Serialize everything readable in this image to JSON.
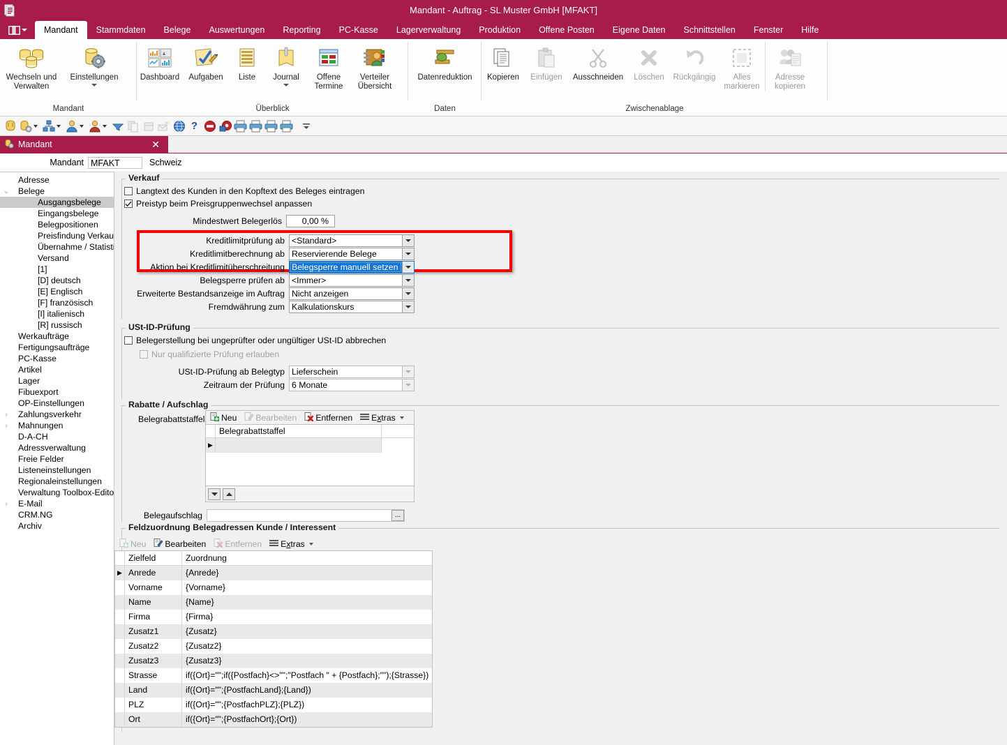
{
  "window": {
    "title": "Mandant - Auftrag - SL Muster GmbH [MFAKT]",
    "app_icon": "application-icon",
    "accent_color": "#A81C4A"
  },
  "ribbon": {
    "quick_access_menu_icon": "ribbon-menu-icon",
    "tabs": [
      {
        "label": "Mandant",
        "active": true
      },
      {
        "label": "Stammdaten",
        "active": false
      },
      {
        "label": "Belege",
        "active": false
      },
      {
        "label": "Auswertungen",
        "active": false
      },
      {
        "label": "Reporting",
        "active": false
      },
      {
        "label": "PC-Kasse",
        "active": false
      },
      {
        "label": "Lagerverwaltung",
        "active": false
      },
      {
        "label": "Produktion",
        "active": false
      },
      {
        "label": "Offene Posten",
        "active": false
      },
      {
        "label": "Eigene Daten",
        "active": false
      },
      {
        "label": "Schnittstellen",
        "active": false
      },
      {
        "label": "Fenster",
        "active": false
      },
      {
        "label": "Hilfe",
        "active": false
      }
    ],
    "groups": [
      {
        "label": "Mandant",
        "buttons": [
          {
            "label": "Wechseln und Verwalten",
            "icon": "databases-icon",
            "disabled": false,
            "dropdown": false
          },
          {
            "label": "Einstellungen",
            "icon": "database-gear-icon",
            "disabled": false,
            "dropdown": true
          }
        ]
      },
      {
        "label": "Überblick",
        "buttons": [
          {
            "label": "Dashboard",
            "icon": "dashboard-icon",
            "disabled": false,
            "dropdown": false
          },
          {
            "label": "Aufgaben",
            "icon": "tasks-icon",
            "disabled": false,
            "dropdown": false
          },
          {
            "label": "Liste",
            "icon": "list-icon",
            "disabled": false,
            "dropdown": false
          },
          {
            "label": "Journal",
            "icon": "journal-icon",
            "disabled": false,
            "dropdown": true
          },
          {
            "label": "Offene Termine",
            "icon": "calendar-icon",
            "disabled": false,
            "dropdown": false
          },
          {
            "label": "Verteiler Übersicht",
            "icon": "distributor-icon",
            "disabled": false,
            "dropdown": false
          }
        ]
      },
      {
        "label": "Daten",
        "buttons": [
          {
            "label": "Datenreduktion",
            "icon": "data-reduction-icon",
            "disabled": false,
            "dropdown": false
          }
        ]
      },
      {
        "label": "Zwischenablage",
        "buttons": [
          {
            "label": "Kopieren",
            "icon": "copy-icon",
            "disabled": false,
            "dropdown": false
          },
          {
            "label": "Einfügen",
            "icon": "paste-icon",
            "disabled": true,
            "dropdown": false
          },
          {
            "label": "Ausschneiden",
            "icon": "cut-icon",
            "disabled": true,
            "dropdown": false
          },
          {
            "label": "Löschen",
            "icon": "delete-icon",
            "disabled": true,
            "dropdown": false
          },
          {
            "label": "Rückgängig",
            "icon": "undo-icon",
            "disabled": true,
            "dropdown": false
          },
          {
            "label": "Alles markieren",
            "icon": "select-all-icon",
            "disabled": true,
            "dropdown": false
          },
          {
            "label": "Adresse kopieren",
            "icon": "copy-address-icon",
            "disabled": true,
            "dropdown": false
          }
        ]
      }
    ]
  },
  "quickbar": {
    "buttons": [
      {
        "icon": "client-icon",
        "dropdown": false,
        "disabled": false
      },
      {
        "icon": "client-settings-icon",
        "dropdown": true,
        "disabled": false
      },
      {
        "icon": "org-chart-icon",
        "dropdown": true,
        "disabled": false
      },
      {
        "icon": "customer-icon",
        "dropdown": true,
        "disabled": false
      },
      {
        "icon": "supplier-icon",
        "dropdown": true,
        "disabled": false
      },
      {
        "icon": "filter-icon",
        "dropdown": false,
        "disabled": false
      },
      {
        "icon": "copy-records-icon",
        "dropdown": false,
        "disabled": true
      },
      {
        "icon": "package-icon",
        "dropdown": false,
        "disabled": true
      },
      {
        "icon": "mail-send-icon",
        "dropdown": false,
        "disabled": true
      },
      {
        "icon": "globe-icon",
        "dropdown": false,
        "disabled": false
      },
      {
        "icon": "help-icon",
        "dropdown": false,
        "disabled": false
      },
      {
        "icon": "stop-icon",
        "dropdown": false,
        "disabled": false
      },
      {
        "icon": "settings-red-icon",
        "dropdown": false,
        "disabled": false
      },
      {
        "icon": "print-icon",
        "dropdown": false,
        "disabled": false
      },
      {
        "icon": "print-preview-icon",
        "dropdown": false,
        "disabled": false
      },
      {
        "icon": "print-setup-icon",
        "dropdown": false,
        "disabled": false
      },
      {
        "icon": "print-direct-icon",
        "dropdown": false,
        "disabled": false
      }
    ],
    "overflow_icon": "toolbar-overflow-icon"
  },
  "document_tab": {
    "icon": "mandant-tab-icon",
    "label": "Mandant",
    "close_label": "✕"
  },
  "mandant_header": {
    "label": "Mandant",
    "value": "MFAKT",
    "country": "Schweiz"
  },
  "tree": {
    "items": [
      {
        "label": "Adresse",
        "level": 1,
        "expander": "",
        "selected": false
      },
      {
        "label": "Belege",
        "level": 1,
        "expander": "v",
        "selected": false
      },
      {
        "label": "Ausgangsbelege",
        "level": 2,
        "expander": "",
        "selected": true
      },
      {
        "label": "Eingangsbelege",
        "level": 2,
        "expander": "",
        "selected": false
      },
      {
        "label": "Belegpositionen",
        "level": 2,
        "expander": "",
        "selected": false
      },
      {
        "label": "Preisfindung Verkauf",
        "level": 2,
        "expander": "",
        "selected": false
      },
      {
        "label": "Übernahme / Statistik",
        "level": 2,
        "expander": "",
        "selected": false
      },
      {
        "label": "Versand",
        "level": 2,
        "expander": "",
        "selected": false
      },
      {
        "label": "[1]",
        "level": 2,
        "expander": "",
        "selected": false
      },
      {
        "label": "[D]  deutsch",
        "level": 2,
        "expander": "",
        "selected": false
      },
      {
        "label": "[E]  Englisch",
        "level": 2,
        "expander": "",
        "selected": false
      },
      {
        "label": "[F]  französisch",
        "level": 2,
        "expander": "",
        "selected": false
      },
      {
        "label": "[I]  italienisch",
        "level": 2,
        "expander": "",
        "selected": false
      },
      {
        "label": "[R]  russisch",
        "level": 2,
        "expander": "",
        "selected": false
      },
      {
        "label": "Werkaufträge",
        "level": 1,
        "expander": "",
        "selected": false
      },
      {
        "label": "Fertigungsaufträge",
        "level": 1,
        "expander": "",
        "selected": false
      },
      {
        "label": "PC-Kasse",
        "level": 1,
        "expander": "",
        "selected": false
      },
      {
        "label": "Artikel",
        "level": 1,
        "expander": "",
        "selected": false
      },
      {
        "label": "Lager",
        "level": 1,
        "expander": "",
        "selected": false
      },
      {
        "label": "Fibuexport",
        "level": 1,
        "expander": "",
        "selected": false
      },
      {
        "label": "OP-Einstellungen",
        "level": 1,
        "expander": "",
        "selected": false
      },
      {
        "label": "Zahlungsverkehr",
        "level": 1,
        "expander": ">",
        "selected": false
      },
      {
        "label": "Mahnungen",
        "level": 1,
        "expander": ">",
        "selected": false
      },
      {
        "label": "D-A-CH",
        "level": 1,
        "expander": "",
        "selected": false
      },
      {
        "label": "Adressverwaltung",
        "level": 1,
        "expander": "",
        "selected": false
      },
      {
        "label": "Freie Felder",
        "level": 1,
        "expander": "",
        "selected": false
      },
      {
        "label": "Listeneinstellungen",
        "level": 1,
        "expander": "",
        "selected": false
      },
      {
        "label": "Regionaleinstellungen",
        "level": 1,
        "expander": "",
        "selected": false
      },
      {
        "label": "Verwaltung Toolbox-Editor",
        "level": 1,
        "expander": "",
        "selected": false
      },
      {
        "label": "E-Mail",
        "level": 1,
        "expander": ">",
        "selected": false
      },
      {
        "label": "CRM.NG",
        "level": 1,
        "expander": "",
        "selected": false
      },
      {
        "label": "Archiv",
        "level": 1,
        "expander": "",
        "selected": false
      }
    ]
  },
  "verkauf": {
    "title": "Verkauf",
    "checkbox_langtext": {
      "label": "Langtext des Kunden in den Kopftext des Beleges eintragen",
      "checked": false
    },
    "checkbox_preistyp": {
      "label": "Preistyp beim Preisgruppenwechsel anpassen",
      "checked": true
    },
    "mindestwert": {
      "label": "Mindestwert Belegerlös",
      "value": "0,00 %"
    },
    "fields": [
      {
        "label": "Kreditlimitprüfung ab",
        "value": "<Standard>",
        "focused": false,
        "disabled": false
      },
      {
        "label": "Kreditlimitberechnung ab",
        "value": "Reservierende Belege",
        "focused": false,
        "disabled": false
      },
      {
        "label": "Aktion bei Kreditlimitüberschreitung",
        "value": "Belegsperre manuell setzen",
        "focused": true,
        "disabled": false
      },
      {
        "label": "Belegsperre prüfen ab",
        "value": "<Immer>",
        "focused": false,
        "disabled": false
      },
      {
        "label": "Erweiterte Bestandsanzeige im Auftrag",
        "value": "Nicht anzeigen",
        "focused": false,
        "disabled": false
      },
      {
        "label": "Fremdwährung zum",
        "value": "Kalkulationskurs",
        "focused": false,
        "disabled": false
      }
    ],
    "highlight_color": "#f50000"
  },
  "ustid": {
    "title": "USt-ID-Prüfung",
    "checkbox_abbrechen": {
      "label": "Belegerstellung bei ungeprüfter oder ungültiger USt-ID abbrechen",
      "checked": false,
      "disabled": false
    },
    "checkbox_qualifiziert": {
      "label": "Nur qualifizierte Prüfung erlauben",
      "checked": false,
      "disabled": true
    },
    "fields": [
      {
        "label": "USt-ID-Prüfung ab Belegtyp",
        "value": "Lieferschein",
        "disabled": true
      },
      {
        "label": "Zeitraum der Prüfung",
        "value": "6 Monate",
        "disabled": true
      }
    ]
  },
  "rabatte": {
    "title": "Rabatte / Aufschlag",
    "staffeln_label": "Belegrabattstaffeln",
    "toolbar": [
      {
        "label": "Neu",
        "icon": "new-icon",
        "disabled": false
      },
      {
        "label": "Bearbeiten",
        "icon": "edit-icon",
        "disabled": true
      },
      {
        "label": "Entfernen",
        "icon": "remove-icon",
        "disabled": false
      },
      {
        "label": "Extras",
        "icon": "extras-icon",
        "disabled": false,
        "dropdown": true
      }
    ],
    "grid_header": "Belegrabattstaffel",
    "grid_rows": [
      {
        "marker": "▶",
        "value": ""
      }
    ],
    "scroll_down_icon": "scroll-down-icon",
    "scroll_up_icon": "scroll-up-icon",
    "aufschlag": {
      "label": "Belegaufschlag",
      "value": "",
      "browse_label": "..."
    }
  },
  "feldzuordnung": {
    "title": "Feldzuordnung Belegadressen Kunde / Interessent",
    "toolbar": [
      {
        "label": "Neu",
        "icon": "new-icon",
        "disabled": true
      },
      {
        "label": "Bearbeiten",
        "icon": "edit-icon",
        "disabled": false
      },
      {
        "label": "Entfernen",
        "icon": "remove-icon",
        "disabled": true
      },
      {
        "label": "Extras",
        "icon": "extras-icon",
        "disabled": false,
        "dropdown": true
      }
    ],
    "columns": [
      "Zielfeld",
      "Zuordnung"
    ],
    "rows": [
      {
        "marker": "▶",
        "zielfeld": "Anrede",
        "zuordnung": "{Anrede}"
      },
      {
        "marker": "",
        "zielfeld": "Vorname",
        "zuordnung": "{Vorname}"
      },
      {
        "marker": "",
        "zielfeld": "Name",
        "zuordnung": "{Name}"
      },
      {
        "marker": "",
        "zielfeld": "Firma",
        "zuordnung": "{Firma}"
      },
      {
        "marker": "",
        "zielfeld": "Zusatz1",
        "zuordnung": "{Zusatz}"
      },
      {
        "marker": "",
        "zielfeld": "Zusatz2",
        "zuordnung": "{Zusatz2}"
      },
      {
        "marker": "",
        "zielfeld": "Zusatz3",
        "zuordnung": "{Zusatz3}"
      },
      {
        "marker": "",
        "zielfeld": "Strasse",
        "zuordnung": "if({Ort}=\"\";if({Postfach}<>\"\";\"Postfach \" + {Postfach};\"\");{Strasse})"
      },
      {
        "marker": "",
        "zielfeld": "Land",
        "zuordnung": "if({Ort}=\"\";{PostfachLand};{Land})"
      },
      {
        "marker": "",
        "zielfeld": "PLZ",
        "zuordnung": "if({Ort}=\"\";{PostfachPLZ};{PLZ})"
      },
      {
        "marker": "",
        "zielfeld": "Ort",
        "zuordnung": "if({Ort}=\"\";{PostfachOrt};{Ort})"
      }
    ]
  }
}
